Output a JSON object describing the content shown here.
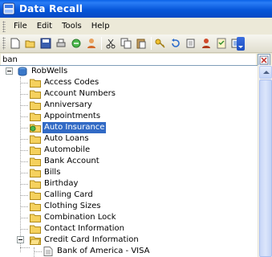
{
  "window": {
    "title": "Data Recall"
  },
  "menu": [
    "File",
    "Edit",
    "Tools",
    "Help"
  ],
  "toolbar": {
    "buttons": [
      "new-file-icon",
      "open-folder-icon",
      "save-icon",
      "print-icon",
      "sync-icon",
      "user-icon",
      "cut-icon",
      "copy-icon",
      "paste-icon",
      "key-icon",
      "undo-icon",
      "copy-record-icon",
      "user-group-icon",
      "checklist-icon",
      "list-view-icon"
    ]
  },
  "search": {
    "value": "ban"
  },
  "tree": {
    "root": "RobWells",
    "items": [
      "Access Codes",
      "Account Numbers",
      "Anniversary",
      "Appointments",
      "Auto Insurance",
      "Auto Loans",
      "Automobile",
      "Bank Account",
      "Bills",
      "Birthday",
      "Calling Card",
      "Clothing Sizes",
      "Combination Lock",
      "Contact Information",
      "Credit Card Information"
    ],
    "selected": "Auto Insurance",
    "sub_items": [
      "Bank of America - VISA"
    ]
  },
  "colors": {
    "titlebar": "#0757DA",
    "selection": "#316AC5",
    "folder": "#F5D15E"
  }
}
